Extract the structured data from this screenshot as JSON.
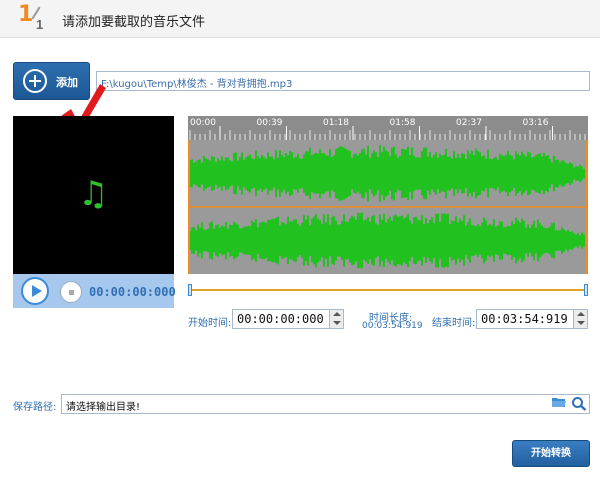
{
  "header": {
    "step_current": "1",
    "step_total": "1",
    "title": "请添加要截取的音乐文件"
  },
  "add_button": {
    "label": "添加"
  },
  "file_path": "F:\\kugou\\Temp\\林俊杰 - 背对背拥抱.mp3",
  "player": {
    "time": "00:00:00:000",
    "icon": "music-note-icon"
  },
  "ruler_labels": [
    "00:00",
    "00:39",
    "01:18",
    "01:58",
    "02:37",
    "03:16"
  ],
  "trim": {
    "start_label": "开始时间:",
    "start_value": "00:00:00:000",
    "duration_label": "时间长度:",
    "duration_value": "00:03:54:919",
    "end_label": "结束时间:",
    "end_value": "00:03:54:919"
  },
  "save": {
    "label": "保存路径:",
    "placeholder": "请选择输出目录!"
  },
  "convert_button": {
    "label": "开始转换"
  },
  "colors": {
    "accent": "#f08a24",
    "wave": "#21c21f",
    "blue": "#2f6fb3"
  }
}
